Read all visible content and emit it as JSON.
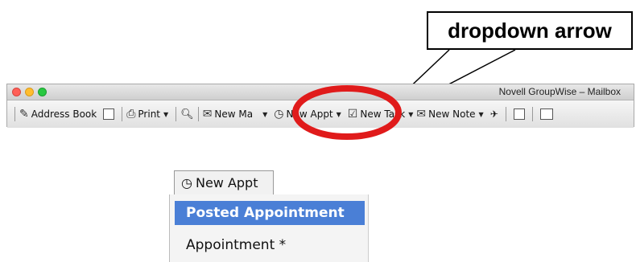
{
  "callout": {
    "label": "dropdown arrow"
  },
  "window": {
    "title": "Novell GroupWise  –  Mailbox"
  },
  "toolbar": {
    "address_book": "Address Book",
    "print": "Print",
    "new_mail": "New Ma",
    "new_appt": "New Appt",
    "new_task": "New Task",
    "new_note": "New Note"
  },
  "dropdown": {
    "button_label": "New Appt",
    "items": [
      {
        "label": "Posted Appointment",
        "selected": true
      },
      {
        "label": "Appointment *",
        "selected": false
      }
    ]
  },
  "colors": {
    "highlight_ring": "#e01b1b",
    "selection": "#4a7fd6"
  }
}
